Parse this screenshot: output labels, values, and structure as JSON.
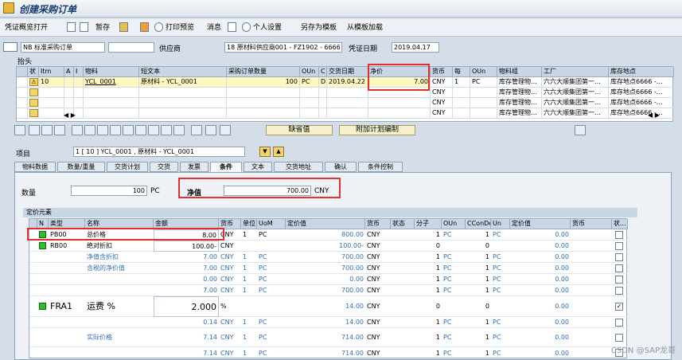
{
  "title": "创建采购订单",
  "toolbar": {
    "items": [
      "凭证概览打开",
      "暂存",
      "打印预览",
      "消息",
      "个人设置",
      "另存为模板",
      "从模板加载"
    ]
  },
  "header": {
    "doc_type": "NB 标准采购订单",
    "vendor_label": "供应商",
    "vendor_value": "18 原材料供应商001 - FZ1902 - 6666",
    "doc_date_label": "凭证日期",
    "doc_date_value": "2019.04.17"
  },
  "tree_label": "抬头",
  "items_table": {
    "columns": [
      "状",
      "Itm",
      "A",
      "I",
      "物料",
      "短文本",
      "采购订单数量",
      "OUn",
      "C",
      "交货日期",
      "净价",
      "货币",
      "每",
      "OUn",
      "物料组",
      "工厂",
      "库存地点"
    ],
    "rows": [
      {
        "item": "10",
        "material": "YCL_0001",
        "short_text": "原材料 - YCL_0001",
        "qty": "100",
        "oun": "PC",
        "c": "D",
        "date": "2019.04.22",
        "net_price": "7.00",
        "currency": "CNY",
        "per": "1",
        "oun2": "PC",
        "mat_group": "库存管理物…",
        "plant": "六六大顺集团第一…",
        "sloc": "库存地点6666 -…"
      },
      {
        "item": "",
        "material": "",
        "short_text": "",
        "qty": "",
        "oun": "",
        "c": "",
        "date": "",
        "net_price": "",
        "currency": "CNY",
        "per": "",
        "oun2": "",
        "mat_group": "库存管理物…",
        "plant": "六六大顺集团第一…",
        "sloc": "库存地点6666 -…"
      },
      {
        "item": "",
        "material": "",
        "short_text": "",
        "qty": "",
        "oun": "",
        "c": "",
        "date": "",
        "net_price": "",
        "currency": "CNY",
        "per": "",
        "oun2": "",
        "mat_group": "库存管理物…",
        "plant": "六六大顺集团第一…",
        "sloc": "库存地点6666 -…"
      },
      {
        "item": "",
        "material": "",
        "short_text": "",
        "qty": "",
        "oun": "",
        "c": "",
        "date": "",
        "net_price": "",
        "currency": "CNY",
        "per": "",
        "oun2": "",
        "mat_group": "库存管理物…",
        "plant": "六六大顺集团第一…",
        "sloc": "库存地点6666 -…"
      }
    ]
  },
  "buttons": {
    "default_values": "缺省值",
    "addl_planning": "附加计划编制"
  },
  "item_section": {
    "label": "项目",
    "selected": "1 [ 10 ] YCL_0001 , 原材料 - YCL_0001"
  },
  "tabs": [
    "物料数据",
    "数量/重量",
    "交货计划",
    "交货",
    "发票",
    "条件",
    "文本",
    "交货地址",
    "确认",
    "条件控制"
  ],
  "active_tab": "条件",
  "conditions": {
    "qty_label": "数量",
    "qty_value": "100",
    "qty_unit": "PC",
    "net_label": "净值",
    "net_value": "700.00",
    "net_currency": "CNY",
    "section_label": "定价元素",
    "columns": [
      "N",
      "类型",
      "名称",
      "金额",
      "货币",
      "单位",
      "UoM",
      "定价值",
      "货币",
      "状态",
      "分子",
      "OUn",
      "CConDe",
      "Un",
      "定价值",
      "货币",
      "状..."
    ],
    "rows": [
      {
        "type": "PB00",
        "name": "总价格",
        "amount": "8.00",
        "curr": "CNY",
        "unit": "1",
        "uom": "PC",
        "value": "800.00",
        "curr2": "CNY",
        "num": "1",
        "oun": "PC",
        "ccon": "1",
        "un": "PC",
        "value2": "0.00",
        "check": ""
      },
      {
        "type": "RB00",
        "name": "绝对折扣",
        "amount": "100.00-",
        "curr": "CNY",
        "unit": "",
        "uom": "",
        "value": "100.00-",
        "curr2": "CNY",
        "num": "0",
        "oun": "",
        "ccon": "0",
        "un": "",
        "value2": "0.00",
        "check": ""
      },
      {
        "type": "",
        "name": "净值含折扣",
        "amount": "7.00",
        "curr": "CNY",
        "unit": "1",
        "uom": "PC",
        "value": "700.00",
        "curr2": "CNY",
        "num": "1",
        "oun": "PC",
        "ccon": "1",
        "un": "PC",
        "value2": "0.00",
        "check": ""
      },
      {
        "type": "",
        "name": "含税的净价值",
        "amount": "7.00",
        "curr": "CNY",
        "unit": "1",
        "uom": "PC",
        "value": "700.00",
        "curr2": "CNY",
        "num": "1",
        "oun": "PC",
        "ccon": "1",
        "un": "PC",
        "value2": "0.00",
        "check": ""
      },
      {
        "type": "",
        "name": "",
        "amount": "0.00",
        "curr": "CNY",
        "unit": "1",
        "uom": "PC",
        "value": "0.00",
        "curr2": "CNY",
        "num": "1",
        "oun": "PC",
        "ccon": "1",
        "un": "PC",
        "value2": "0.00",
        "check": ""
      },
      {
        "type": "",
        "name": "",
        "amount": "7.00",
        "curr": "CNY",
        "unit": "1",
        "uom": "PC",
        "value": "700.00",
        "curr2": "CNY",
        "num": "1",
        "oun": "PC",
        "ccon": "1",
        "un": "PC",
        "value2": "0.00",
        "check": ""
      },
      {
        "type": "FRA1",
        "name": "运费 %",
        "amount": "2.000",
        "curr": "%",
        "unit": "",
        "uom": "",
        "value": "14.00",
        "curr2": "CNY",
        "num": "0",
        "oun": "",
        "ccon": "0",
        "un": "",
        "value2": "0.00",
        "check": "✓"
      },
      {
        "type": "",
        "name": "",
        "amount": "0.14",
        "curr": "CNY",
        "unit": "1",
        "uom": "PC",
        "value": "14.00",
        "curr2": "CNY",
        "num": "1",
        "oun": "PC",
        "ccon": "1",
        "un": "PC",
        "value2": "0.00",
        "check": ""
      },
      {
        "type": "",
        "name": "实际价格",
        "amount": "7.14",
        "curr": "CNY",
        "unit": "1",
        "uom": "PC",
        "value": "714.00",
        "curr2": "CNY",
        "num": "1",
        "oun": "PC",
        "ccon": "1",
        "un": "PC",
        "value2": "0.00",
        "check": ""
      },
      {
        "type": "",
        "name": "",
        "amount": "7.14",
        "curr": "CNY",
        "unit": "1",
        "uom": "PC",
        "value": "714.00",
        "curr2": "CNY",
        "num": "1",
        "oun": "PC",
        "ccon": "1",
        "un": "PC",
        "value2": "0.00",
        "check": ""
      }
    ]
  },
  "watermark": "CSDN @SAP龙哥"
}
